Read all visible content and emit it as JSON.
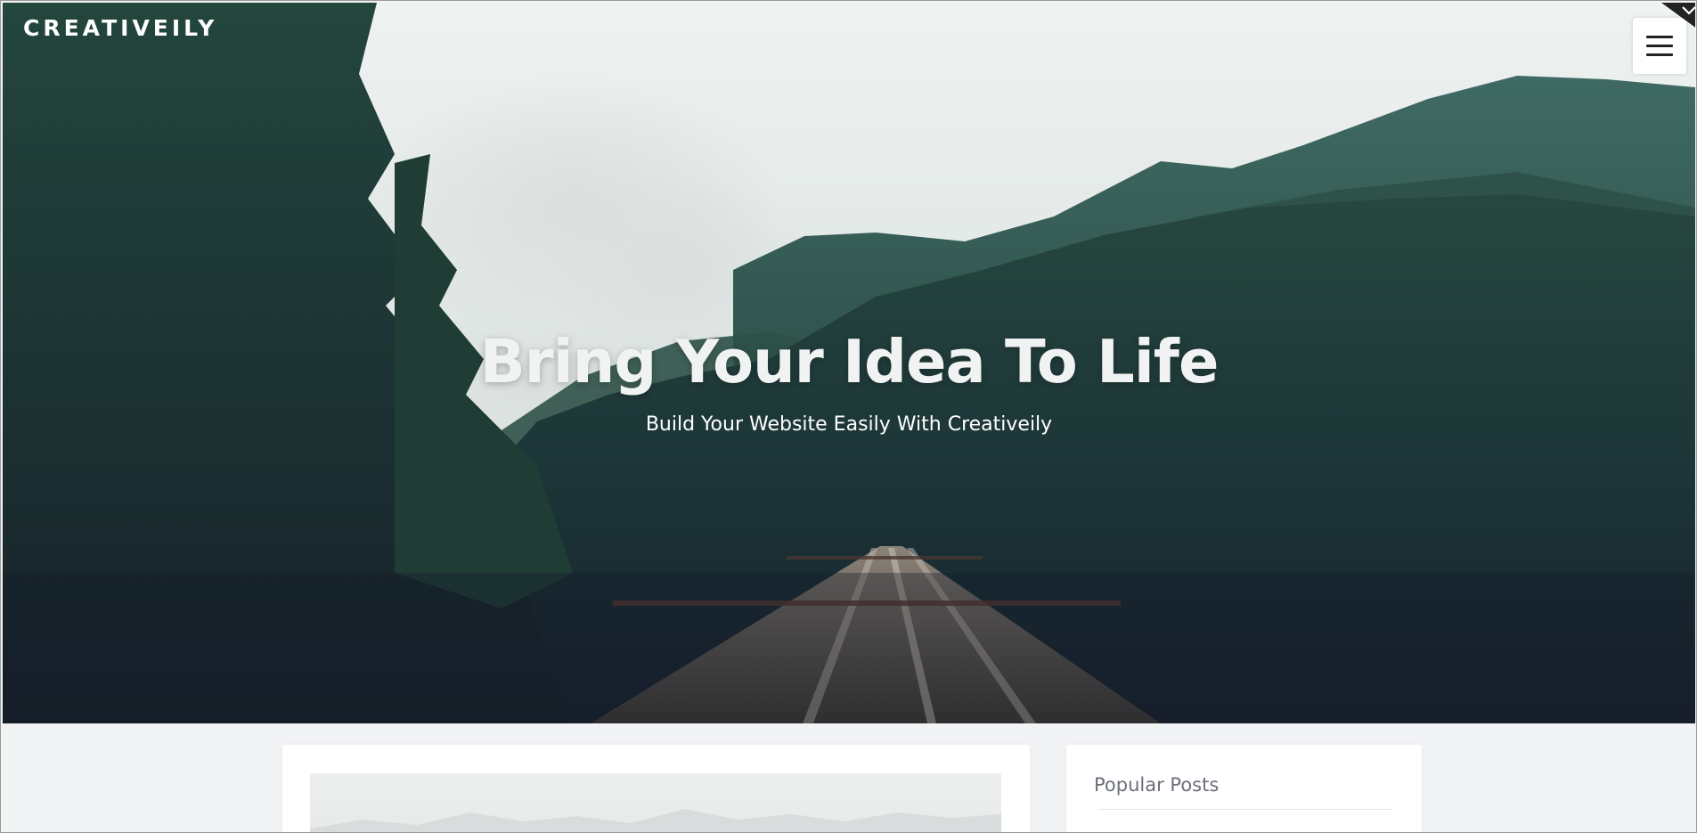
{
  "header": {
    "brand": "CREATIVEILY",
    "menu_icon": "hamburger-icon",
    "toggle_icon": "chevron-down-icon"
  },
  "hero": {
    "title": "Bring Your Idea To Life",
    "subtitle": "Build Your Website Easily With Creativeily",
    "background": "forest-railway-bridge-photo"
  },
  "sidebar": {
    "widget_title": "Popular Posts"
  },
  "colors": {
    "page_background": "#f2f3f5",
    "card_background": "#ffffff",
    "hero_text": "#ffffff",
    "widget_title": "#6b6f78"
  }
}
